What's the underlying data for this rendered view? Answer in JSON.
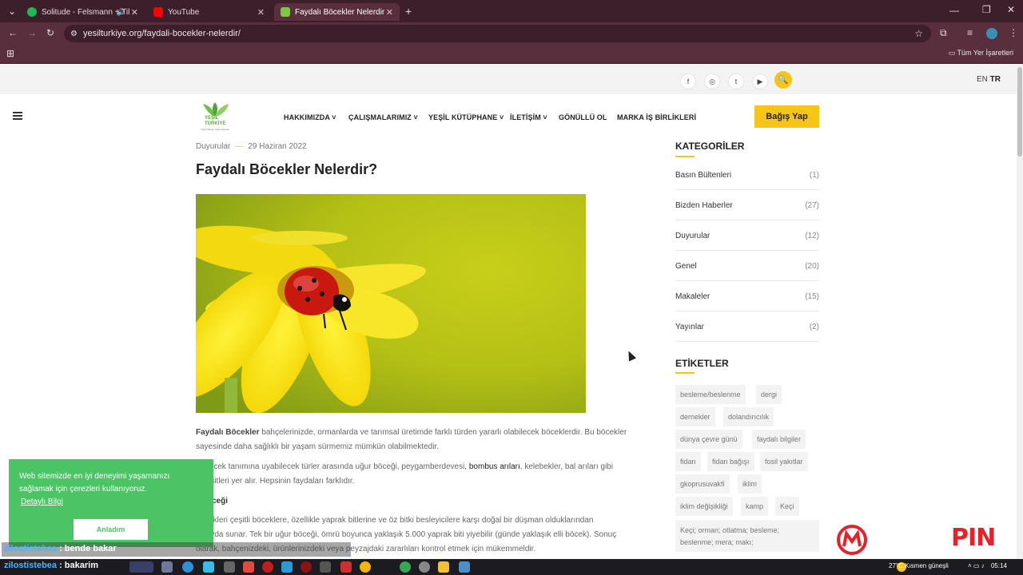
{
  "browser": {
    "tabs": [
      {
        "label": "Solitude - Felsmann + Tiley",
        "favicon_color": "#1db954"
      },
      {
        "label": "YouTube",
        "favicon_color": "#ff0000"
      },
      {
        "label": "Faydalı Böcekler Nelerdir? - Ye",
        "favicon_color": "#7ac943"
      }
    ],
    "new_tab": "+",
    "url": "yesilturkiye.org/faydali-bocekler-nelerdir/",
    "bookmarks_label": "Tüm Yer İşaretleri"
  },
  "site": {
    "social": [
      "f",
      "◎",
      "t",
      "▶"
    ],
    "lang_en": "EN",
    "lang_tr": "TR",
    "logo_line1": "YEŞİL",
    "logo_line2": "TÜRKİYE",
    "logo_tagline": "Yeşil Türkiye Yeşil Gelecek",
    "nav": [
      "HAKKIMIZDA",
      "ÇALIŞMALARIMIZ",
      "YEŞİL KÜTÜPHANE",
      "İLETİŞİM",
      "GÖNÜLLÜ OL",
      "MARKA İŞ BİRLİKLERİ"
    ],
    "donate_label": "Bağış Yap"
  },
  "article": {
    "category": "Duyurular",
    "date": "29 Haziran 2022",
    "title": "Faydalı Böcekler Nelerdir?",
    "p1_bold": "Faydalı Böcekler",
    "p1_rest": " bahçelerinizde, ormanlarda ve tarımsal üretimde farklı türden yararlı olabilecek böceklerdir. Bu böcekler sayesinde daha sağlıklı bir yaşam sürmemiz mümkün olabilmektedir.",
    "p2_a": "rlı böcek tanımına uyabilecek türler arasında uğur böceği, peygamberdevesi, ",
    "p2_link": "bombus arıları",
    "p2_b": ", kelebekler, bal arıları gibi",
    "p2_c": "k çeşitleri yer alır. Hepsinin faydaları farklıdır.",
    "p3_heading": "r Böceği",
    "p4_a": "böcekleri çeşitli böceklere, özellikle yaprak bitlerine ve öz bitki besleyicilere karşı doğal bir düşman olduklarından",
    "p4_b": "iz fayda sunar. Tek bir uğur böceği, ömrü boyunca yaklaşık 5.000 yaprak biti yiyebilir (günde yaklaşık elli böcek). Sonuç",
    "p4_c": "olarak, bahçenizdeki, ürünlerinizdeki veya peyzajdaki zararlıları kontrol etmek için mükemmeldir."
  },
  "sidebar": {
    "categories_title": "KATEGORİLER",
    "categories": [
      {
        "name": "Basın Bültenleri",
        "count": "(1)"
      },
      {
        "name": "Bizden Haberler",
        "count": "(27)"
      },
      {
        "name": "Duyurular",
        "count": "(12)"
      },
      {
        "name": "Genel",
        "count": "(20)"
      },
      {
        "name": "Makaleler",
        "count": "(15)"
      },
      {
        "name": "Yayınlar",
        "count": "(2)"
      }
    ],
    "tags_title": "ETİKETLER",
    "tags": [
      "besleme/beslenme",
      "dergi",
      "dernekler",
      "dolandırıcılık",
      "dünya çevre günü",
      "faydalı bilgiler",
      "fidan",
      "fidan bağışı",
      "fosil yakıtlar",
      "gkoprusuvakfi",
      "iklim",
      "iklim değişikliği",
      "kamp",
      "Keçi",
      "Keçi; orman; otlatma; besleme; beslenme; mera; makı;"
    ]
  },
  "cookie": {
    "message": "Web sitemizde en iyi deneyimi yaşamanızı sağlamak için çerezleri kullanıyoruz.",
    "more_link": "Detaylı Bilgi",
    "accept": "Anladım"
  },
  "overlay": {
    "chat1_user": "zilostistebea",
    "chat1_msg": " : bende bakar",
    "chat2_user": "zilostistebea",
    "chat2_msg": " : bakarim",
    "brand_pin": "PIN"
  },
  "taskbar": {
    "weather": "27°C  Kısmen güneşli",
    "time": "05:14"
  }
}
